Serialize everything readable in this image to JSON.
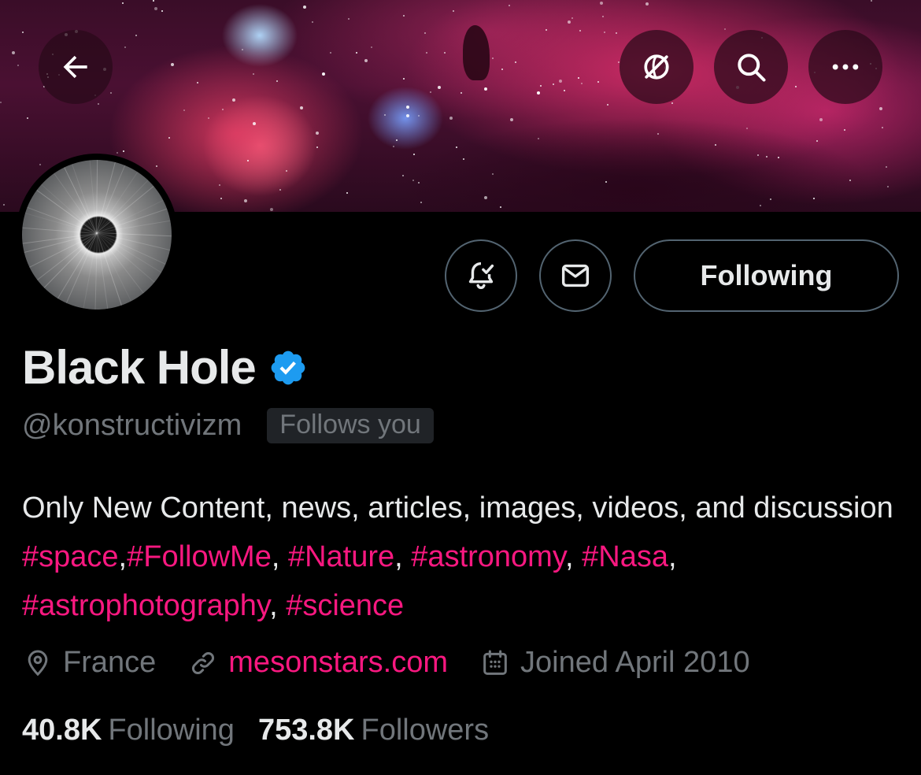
{
  "profile": {
    "name": "Black Hole",
    "handle": "@konstructivizm",
    "follows_you": "Follows you",
    "verified": true,
    "bio_parts": [
      {
        "text": "Only New Content, news, articles, images, videos, and discussion ",
        "type": "text"
      },
      {
        "text": "#space",
        "type": "tag"
      },
      {
        "text": ",",
        "type": "text"
      },
      {
        "text": "#FollowMe",
        "type": "tag"
      },
      {
        "text": ", ",
        "type": "text"
      },
      {
        "text": "#Nature",
        "type": "tag"
      },
      {
        "text": ", ",
        "type": "text"
      },
      {
        "text": "#astronomy",
        "type": "tag"
      },
      {
        "text": ", ",
        "type": "text"
      },
      {
        "text": "#Nasa",
        "type": "tag"
      },
      {
        "text": ", ",
        "type": "text"
      },
      {
        "text": "#astrophotography",
        "type": "tag"
      },
      {
        "text": ", ",
        "type": "text"
      },
      {
        "text": "#science",
        "type": "tag"
      }
    ],
    "location": "France",
    "website": "mesonstars.com",
    "joined": "Joined April 2010",
    "following_count": "40.8K",
    "following_label": "Following",
    "followers_count": "753.8K",
    "followers_label": "Followers"
  },
  "actions": {
    "follow_button_label": "Following",
    "back_icon": "arrow-left-icon",
    "translate_icon": "globe-off-icon",
    "search_icon": "search-icon",
    "more_icon": "more-icon",
    "notify_icon": "bell-check-icon",
    "message_icon": "envelope-icon"
  },
  "colors": {
    "accent": "#f91880",
    "verified_blue": "#1d9bf0",
    "secondary_text": "#71767b",
    "border": "#536471",
    "background": "#000000"
  }
}
